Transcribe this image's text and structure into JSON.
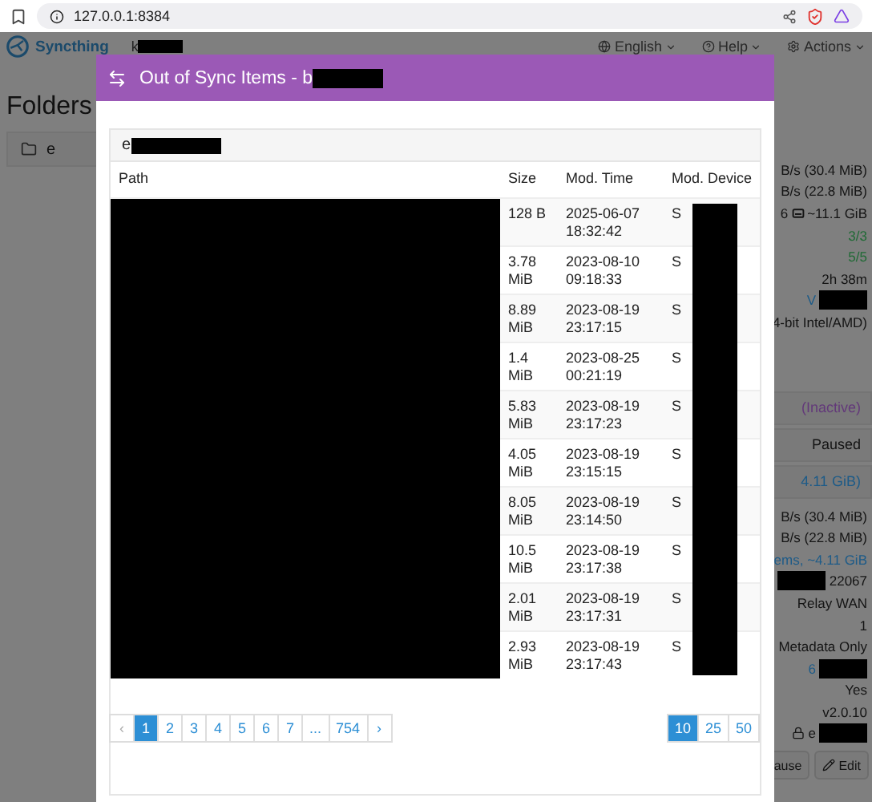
{
  "browser": {
    "url": "127.0.0.1:8384"
  },
  "navbar": {
    "brand": "Syncthing",
    "device": "k",
    "menus": [
      {
        "label": "English",
        "kind": "language"
      },
      {
        "label": "Help",
        "kind": "help"
      },
      {
        "label": "Actions",
        "kind": "actions"
      }
    ]
  },
  "folders": {
    "title": "Folders",
    "items": [
      {
        "name": "e"
      }
    ]
  },
  "device_panel": {
    "items": [
      {
        "kind": "text",
        "color": "#141414",
        "text": "B/s (30.4 MiB)"
      },
      {
        "kind": "text",
        "color": "#141414",
        "text": "B/s (22.8 MiB)"
      },
      {
        "kind": "disk",
        "color": "#141414",
        "text": "6",
        "extra": "~11.1 GiB"
      },
      {
        "kind": "text",
        "color": "#1f6a35",
        "text": "3/3"
      },
      {
        "kind": "text",
        "color": "#1f6a35",
        "text": "5/5"
      },
      {
        "kind": "text",
        "color": "#141414",
        "text": "2h 38m"
      },
      {
        "kind": "redacted_after",
        "color": "#1d5b88",
        "text": "V"
      },
      {
        "kind": "text",
        "color": "#141414",
        "text": "4-bit Intel/AMD)"
      },
      {
        "kind": "panel",
        "color": "#63397a",
        "text": "(Inactive)"
      },
      {
        "kind": "panel",
        "color": "#141414",
        "text": "Paused"
      },
      {
        "kind": "panel",
        "color": "#1d5b88",
        "text": "4.11 GiB)"
      },
      {
        "kind": "text",
        "color": "#141414",
        "text": "B/s (30.4 MiB)"
      },
      {
        "kind": "text",
        "color": "#141414",
        "text": "B/s (22.8 MiB)"
      },
      {
        "kind": "text",
        "color": "#1d5b88",
        "text": "ems, ~4.11 GiB"
      },
      {
        "kind": "redacted_before",
        "color": "#141414",
        "text": "22067"
      },
      {
        "kind": "text",
        "color": "#141414",
        "text": "Relay WAN"
      },
      {
        "kind": "text",
        "color": "#141414",
        "text": "1"
      },
      {
        "kind": "text",
        "color": "#141414",
        "text": "Metadata Only"
      },
      {
        "kind": "redacted_after",
        "color": "#1d5b88",
        "text": "6"
      },
      {
        "kind": "text",
        "color": "#141414",
        "text": "Yes"
      },
      {
        "kind": "text",
        "color": "#141414",
        "text": "v2.0.10"
      },
      {
        "kind": "lock",
        "color": "#141414",
        "text": "e"
      }
    ],
    "buttons": [
      {
        "label": "ause",
        "kind": "pause"
      },
      {
        "label": "Edit",
        "kind": "edit"
      }
    ]
  },
  "modal": {
    "title": "Out of Sync Items - b",
    "folder": "e",
    "columns": [
      "Path",
      "Size",
      "Mod. Time",
      "Mod. Device"
    ],
    "rows": [
      {
        "size": "128 B",
        "time": "2025-06-07 18:32:42",
        "device": "S"
      },
      {
        "size": "3.78 MiB",
        "time": "2023-08-10 09:18:33",
        "device": "S"
      },
      {
        "size": "8.89 MiB",
        "time": "2023-08-19 23:17:15",
        "device": "S"
      },
      {
        "size": "1.4 MiB",
        "time": "2023-08-25 00:21:19",
        "device": "S"
      },
      {
        "size": "5.83 MiB",
        "time": "2023-08-19 23:17:23",
        "device": "S"
      },
      {
        "size": "4.05 MiB",
        "time": "2023-08-19 23:15:15",
        "device": "S"
      },
      {
        "size": "8.05 MiB",
        "time": "2023-08-19 23:14:50",
        "device": "S"
      },
      {
        "size": "10.5 MiB",
        "time": "2023-08-19 23:17:38",
        "device": "S"
      },
      {
        "size": "2.01 MiB",
        "time": "2023-08-19 23:17:31",
        "device": "S"
      },
      {
        "size": "2.93 MiB",
        "time": "2023-08-19 23:17:43",
        "device": "S"
      }
    ],
    "pagination": {
      "prev": "‹",
      "next": "›",
      "pages": [
        {
          "label": "1",
          "selected": true
        },
        {
          "label": "2",
          "selected": false
        },
        {
          "label": "3",
          "selected": false
        },
        {
          "label": "4",
          "selected": false
        },
        {
          "label": "5",
          "selected": false
        },
        {
          "label": "6",
          "selected": false
        },
        {
          "label": "7",
          "selected": false
        },
        {
          "label": "...",
          "selected": false
        },
        {
          "label": "754",
          "selected": false
        }
      ]
    },
    "page_sizes": [
      {
        "label": "10",
        "selected": true
      },
      {
        "label": "25",
        "selected": false
      },
      {
        "label": "50",
        "selected": false
      }
    ]
  }
}
